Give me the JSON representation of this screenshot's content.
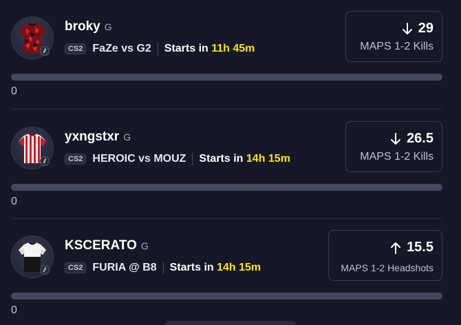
{
  "props": [
    {
      "player": "broky",
      "position": "G",
      "game": "CS2",
      "match": "FaZe vs G2",
      "starts_prefix": "Starts in",
      "starts_time": "11h 45m",
      "direction": "down",
      "value": "29",
      "stat": "MAPS 1-2 Kills",
      "progress_fraction": 0,
      "progress_count": "0",
      "jersey": "faze-red-black-camo"
    },
    {
      "player": "yxngstxr",
      "position": "G",
      "game": "CS2",
      "match": "HEROIC vs MOUZ",
      "starts_prefix": "Starts in",
      "starts_time": "14h 15m",
      "direction": "down",
      "value": "26.5",
      "stat": "MAPS 1-2 Kills",
      "progress_fraction": 0,
      "progress_count": "0",
      "jersey": "red-white-stripes"
    },
    {
      "player": "KSCERATO",
      "position": "G",
      "game": "CS2",
      "match": "FURIA @ B8",
      "starts_prefix": "Starts in",
      "starts_time": "14h 15m",
      "direction": "up",
      "value": "15.5",
      "stat": "MAPS 1-2 Headshots",
      "progress_fraction": 0,
      "progress_count": "0",
      "jersey": "white-black"
    }
  ],
  "colors": {
    "background": "#161827",
    "accent_time": "#f7e51a",
    "track": "#45495d",
    "border": "#3a3d50"
  }
}
